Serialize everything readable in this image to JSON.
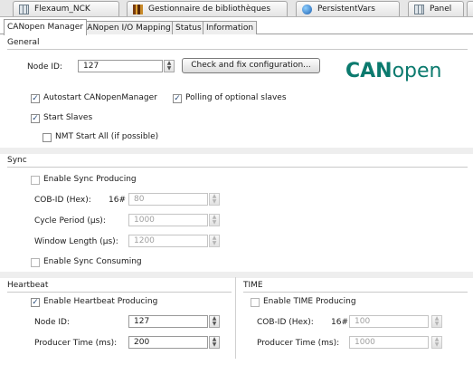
{
  "document_tabs": [
    {
      "label": "Flexaum_NCK",
      "icon": "grid-icon"
    },
    {
      "label": "Gestionnaire de bibliothèques",
      "icon": "library-icon"
    },
    {
      "label": "PersistentVars",
      "icon": "globe-icon"
    },
    {
      "label": "Panel",
      "icon": "grid-icon"
    }
  ],
  "sub_tabs": [
    "CANopen Manager",
    "CANopen I/O Mapping",
    "Status",
    "Information"
  ],
  "general": {
    "title": "General",
    "node_id_label": "Node ID:",
    "node_id_value": "127",
    "check_button": "Check and fix configuration...",
    "logo_bold": "CAN",
    "logo_light": "open",
    "autostart_label": "Autostart CANopenManager",
    "autostart_checked": "✓",
    "polling_label": "Polling of optional slaves",
    "polling_checked": "✓",
    "start_slaves_label": "Start Slaves",
    "start_slaves_checked": "✓",
    "nmt_label": "NMT Start All (if possible)",
    "nmt_checked": ""
  },
  "sync": {
    "title": "Sync",
    "enable_producing_label": "Enable Sync Producing",
    "cobid_label": "COB-ID (Hex):",
    "cobid_prefix": "16#",
    "cobid_value": "80",
    "cycle_label": "Cycle Period (µs):",
    "cycle_value": "1000",
    "window_label": "Window Length (µs):",
    "window_value": "1200",
    "enable_consuming_label": "Enable Sync Consuming"
  },
  "heartbeat": {
    "title": "Heartbeat",
    "enable_label": "Enable Heartbeat Producing",
    "enable_checked": "✓",
    "node_id_label": "Node ID:",
    "node_id_value": "127",
    "producer_time_label": "Producer Time (ms):",
    "producer_time_value": "200"
  },
  "time": {
    "title": "TIME",
    "enable_label": "Enable TIME Producing",
    "cobid_label": "COB-ID (Hex):",
    "cobid_prefix": "16#",
    "cobid_value": "100",
    "producer_time_label": "Producer Time (ms):",
    "producer_time_value": "1000"
  },
  "spin_glyphs": {
    "up": "▲",
    "down": "▼"
  }
}
